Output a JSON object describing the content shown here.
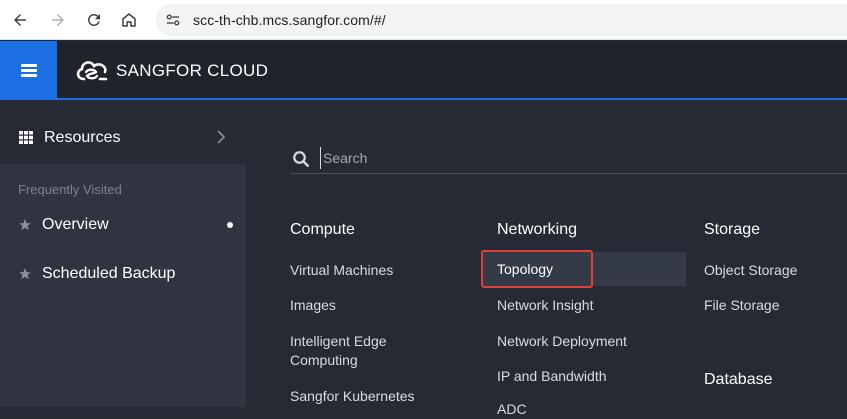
{
  "browser": {
    "url": "scc-th-chb.mcs.sangfor.com/#/"
  },
  "header": {
    "brand": "SANGFOR CLOUD"
  },
  "sidebar": {
    "resources_label": "Resources",
    "section_label": "Frequently Visited",
    "items": [
      {
        "label": "Overview",
        "icon": "star-icon"
      },
      {
        "label": "Scheduled Backup",
        "icon": "star-icon"
      }
    ]
  },
  "search": {
    "placeholder": "Search"
  },
  "columns": {
    "compute": {
      "title": "Compute",
      "links": [
        "Virtual Machines",
        "Images",
        "Intelligent Edge\nComputing",
        "Sangfor Kubernetes"
      ]
    },
    "networking": {
      "title": "Networking",
      "links": [
        "Topology",
        "Network Insight",
        "Network Deployment",
        "IP and Bandwidth",
        "ADC"
      ]
    },
    "storage": {
      "title": "Storage",
      "links": [
        "Object Storage",
        "File Storage"
      ]
    },
    "database": {
      "title": "Database"
    }
  },
  "colors": {
    "accent": "#1b6fe3",
    "highlight_border": "#e0403a",
    "header_bg": "#1f232b",
    "sidebar_bg": "#2f3440",
    "main_bg": "#252a34"
  }
}
